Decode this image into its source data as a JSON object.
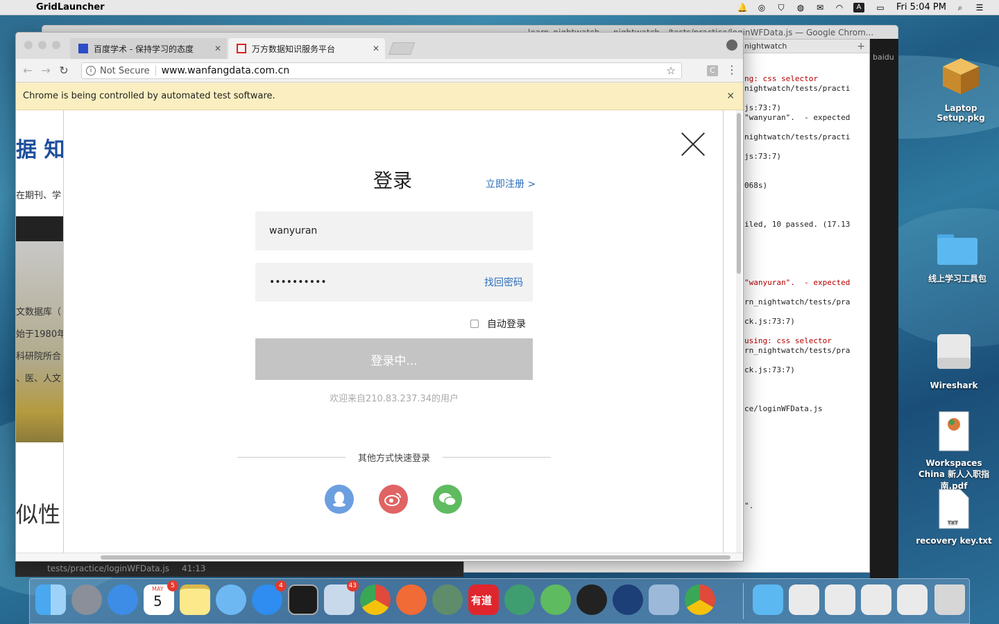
{
  "menubar": {
    "app_name": "GridLauncher",
    "clock": "Fri 5:04 PM"
  },
  "back_window": {
    "title": "learn_nightwatch — nightwatch ../tests/practice/loginWFData.js — Google Chrom..."
  },
  "editor": {
    "tab_label": "nightwatch",
    "status_file": "tests/practice/loginWFData.js",
    "status_pos": "41:13",
    "dark_strip_label": "baidu",
    "lines": [
      {
        "text": "ng: css selector",
        "cls": "red"
      },
      {
        "text": "nightwatch/tests/practi",
        "cls": ""
      },
      {
        "text": "",
        "cls": ""
      },
      {
        "text": "js:73:7)",
        "cls": ""
      },
      {
        "text": "\"wanyuran\".  - expected",
        "cls": ""
      },
      {
        "text": "",
        "cls": ""
      },
      {
        "text": "nightwatch/tests/practi",
        "cls": ""
      },
      {
        "text": "",
        "cls": ""
      },
      {
        "text": "js:73:7)",
        "cls": ""
      },
      {
        "text": "",
        "cls": ""
      },
      {
        "text": "",
        "cls": ""
      },
      {
        "text": "068s)",
        "cls": ""
      },
      {
        "text": "",
        "cls": ""
      },
      {
        "text": "",
        "cls": ""
      },
      {
        "text": "",
        "cls": ""
      },
      {
        "text": "iled, 10 passed. (17.13",
        "cls": ""
      },
      {
        "text": "",
        "cls": ""
      },
      {
        "text": "",
        "cls": ""
      },
      {
        "text": "",
        "cls": ""
      },
      {
        "text": "",
        "cls": ""
      },
      {
        "text": "",
        "cls": ""
      },
      {
        "text": "\"wanyuran\".  - expected",
        "cls": "red"
      },
      {
        "text": "",
        "cls": ""
      },
      {
        "text": "rn_nightwatch/tests/pra",
        "cls": ""
      },
      {
        "text": "",
        "cls": ""
      },
      {
        "text": "ck.js:73:7)",
        "cls": ""
      },
      {
        "text": "",
        "cls": ""
      },
      {
        "text": "using: css selector",
        "cls": "red"
      },
      {
        "text": "rn_nightwatch/tests/pra",
        "cls": ""
      },
      {
        "text": "",
        "cls": ""
      },
      {
        "text": "ck.js:73:7)",
        "cls": ""
      },
      {
        "text": "",
        "cls": ""
      },
      {
        "text": "",
        "cls": ""
      },
      {
        "text": "",
        "cls": ""
      },
      {
        "text": "ce/loginWFData.js",
        "cls": ""
      },
      {
        "text": "",
        "cls": ""
      },
      {
        "text": "",
        "cls": ""
      },
      {
        "text": "",
        "cls": ""
      },
      {
        "text": "",
        "cls": ""
      },
      {
        "text": "",
        "cls": ""
      },
      {
        "text": "",
        "cls": ""
      },
      {
        "text": "",
        "cls": ""
      },
      {
        "text": "",
        "cls": ""
      },
      {
        "text": "",
        "cls": ""
      },
      {
        "text": "\".",
        "cls": ""
      }
    ]
  },
  "chrome": {
    "tabs": [
      {
        "label": "百度学术 - 保持学习的态度",
        "active": false
      },
      {
        "label": "万方数据知识服务平台",
        "active": true
      }
    ],
    "omnibox": {
      "security": "Not Secure",
      "url": "www.wanfangdata.com.cn"
    },
    "infobar": "Chrome is being controlled by automated test software.",
    "extension_letter": "C"
  },
  "background_site": {
    "logo": "据 知",
    "snippets": [
      "在期刊、学",
      "文数据库（",
      "始于1980年",
      "科研院所合",
      "、医、人文"
    ],
    "big_text": "似性"
  },
  "login_dialog": {
    "title": "登录",
    "register_link": "立即注册 >",
    "username_value": "wanyuran",
    "password_mask": "••••••••••",
    "forgot_password": "找回密码",
    "auto_login_label": "自动登录",
    "login_button": "登录中...",
    "welcome": "欢迎来自210.83.237.34的用户",
    "other_methods": "其他方式快速登录",
    "social": [
      {
        "name": "qq",
        "color": "#6c9fe0"
      },
      {
        "name": "weibo",
        "color": "#e06464"
      },
      {
        "name": "wechat",
        "color": "#5fbb5f"
      }
    ]
  },
  "desktop_icons": [
    {
      "label": "Laptop Setup.pkg"
    },
    {
      "label": "线上学习工具包"
    },
    {
      "label": "Wireshark"
    },
    {
      "label": "Workspaces China 新人入职指南.pdf"
    },
    {
      "label": "recovery key.txt"
    }
  ],
  "dock": {
    "calendar_month": "MAY",
    "calendar_day": "5",
    "badges": {
      "calendar": "5",
      "appstore": "4",
      "mail": "43"
    },
    "youdao_label": "有道"
  }
}
